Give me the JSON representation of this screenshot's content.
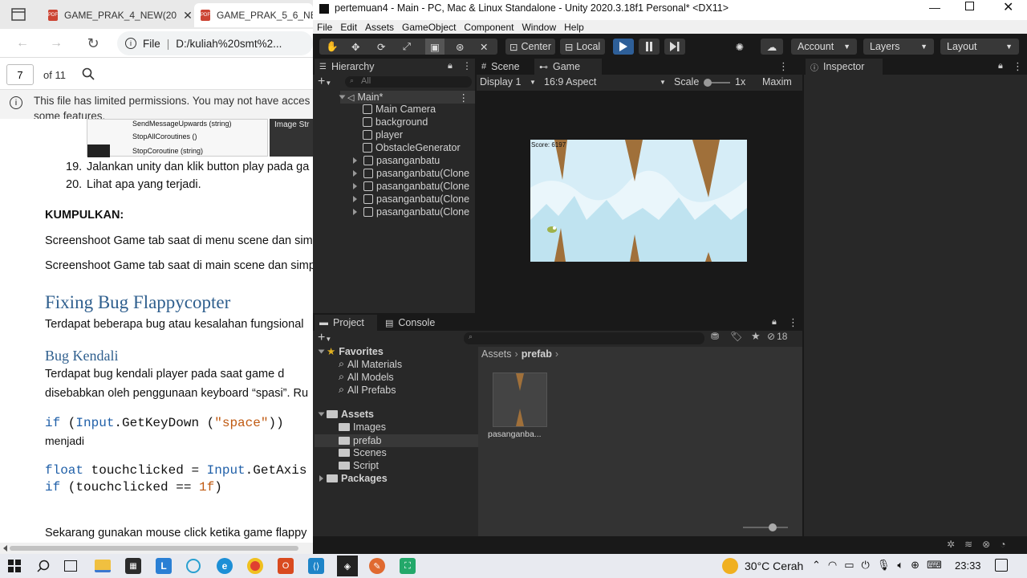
{
  "edge": {
    "tabs": [
      {
        "label": "GAME_PRAK_4_NEW(20"
      },
      {
        "label": "GAME_PRAK_5_6_NEW"
      }
    ],
    "address": {
      "info": "File",
      "url": "D:/kuliah%20smt%2..."
    },
    "pdf": {
      "page": "7",
      "of": "of 11"
    },
    "banner": {
      "line1": "This file has limited permissions. You may not have acces",
      "line2": "some features."
    },
    "doc": {
      "img_rows": [
        "SendMessageUpwards (string)",
        "StopAllCoroutines ()",
        "StopCoroutine (string)"
      ],
      "img_tag": "Image Str",
      "step19_num": "19.",
      "step19": "Jalankan unity dan klik button play pada ga",
      "step20_num": "20.",
      "step20": "Lihat apa yang terjadi.",
      "kumpulkan": "KUMPULKAN:",
      "p1": "Screenshoot Game tab saat di menu scene dan sim",
      "p2": "Screenshoot Game tab saat di main scene dan simp",
      "h1": "Fixing Bug Flappycopter",
      "p3": "Terdapat beberapa bug atau kesalahan fungsional",
      "h2": "Bug Kendali",
      "p4": "Terdapat bug kendali player pada saat game d",
      "p5": "disebabkan oleh penggunaan keyboard “spasi”. Ru",
      "code1": {
        "kw": "if",
        "cls": "Input",
        "mid": ".GetKeyDown (",
        "str": "\"space\"",
        "end": "))"
      },
      "menjadi": "menjadi",
      "code2": {
        "type": "float",
        "mid": " touchclicked = ",
        "cls": "Input",
        "end": ".GetAxis"
      },
      "code3": {
        "kw": "if",
        "mid": " (touchclicked == ",
        "num": "1f",
        "end": ")"
      },
      "p6": "Sekarang gunakan mouse click ketika game flappy"
    }
  },
  "unity": {
    "title": "pertemuan4 - Main - PC, Mac & Linux Standalone - Unity 2020.3.18f1 Personal* <DX11>",
    "menu": [
      "File",
      "Edit",
      "Assets",
      "GameObject",
      "Component",
      "Window",
      "Help"
    ],
    "toolbar": {
      "center": "Center",
      "local": "Local",
      "account": "Account",
      "layers": "Layers",
      "layout": "Layout"
    },
    "hierarchy": {
      "tab": "Hierarchy",
      "search": "All",
      "scene": "Main*",
      "items": [
        {
          "label": "Main Camera"
        },
        {
          "label": "background"
        },
        {
          "label": "player"
        },
        {
          "label": "ObstacleGenerator"
        },
        {
          "label": "pasanganbatu"
        },
        {
          "label": "pasanganbatu(Clone"
        },
        {
          "label": "pasanganbatu(Clone"
        },
        {
          "label": "pasanganbatu(Clone"
        },
        {
          "label": "pasanganbatu(Clone"
        }
      ]
    },
    "game": {
      "scene_tab": "Scene",
      "game_tab": "Game",
      "display": "Display 1",
      "aspect": "16:9 Aspect",
      "scale_label": "Scale",
      "scale_value": "1x",
      "maximize": "Maxim",
      "score": "Score: 6197"
    },
    "inspector": {
      "tab": "Inspector"
    },
    "project": {
      "tab": "Project",
      "console_tab": "Console",
      "hidden_count": "18",
      "favorites": {
        "label": "Favorites",
        "items": [
          "All Materials",
          "All Models",
          "All Prefabs"
        ]
      },
      "assets": {
        "label": "Assets",
        "items": [
          "Images",
          "prefab",
          "Scenes",
          "Script"
        ]
      },
      "packages": "Packages",
      "breadcrumb": {
        "root": "Assets",
        "current": "prefab"
      },
      "asset_tile": "pasanganba..."
    }
  },
  "taskbar": {
    "weather": "30°C  Cerah",
    "time": "23:33"
  },
  "colors": {
    "unity_play": "#2e5f98",
    "pdf_heading": "#2f5f8e",
    "taskbar": "#e8eaf0"
  }
}
